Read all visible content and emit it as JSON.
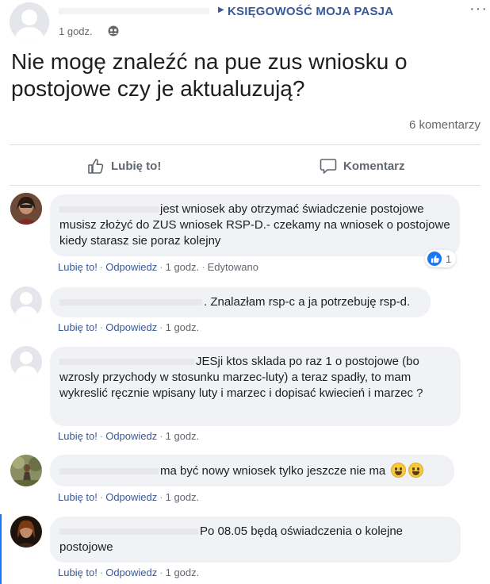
{
  "post": {
    "group_name": "KSIĘGOWOŚĆ MOJA PASJA",
    "time": "1 godz.",
    "audience_icon": "group-audience-icon",
    "more_icon": "more-dots-icon",
    "text": "Nie mogę znaleźć na pue zus wniosku o postojowe czy je aktualuzują?",
    "comments_count": "6 komentarzy"
  },
  "actions": {
    "like_label": "Lubię to!",
    "comment_label": "Komentarz"
  },
  "comments": [
    {
      "text": "jest wniosek aby otrzymać świadczenie postojowe musisz złożyć do ZUS wniosek RSP-D.- czekamy na wniosek o postojowe kiedy starasz sie poraz kolejny",
      "like": "Lubię to!",
      "reply": "Odpowiedz",
      "time": "1 godz.",
      "edited": "Edytowano",
      "reaction_count": "1"
    },
    {
      "text": ". Znalazłam rsp-c a ja potrzebuję rsp-d.",
      "like": "Lubię to!",
      "reply": "Odpowiedz",
      "time": "1 godz."
    },
    {
      "text": "JESji ktos sklada po raz 1 o postojowe (bo wzrosly przychody w stosunku marzec-luty) a teraz spadły, to mam wykreslić ręcznie wpisany luty i marzec i dopisać kwiecień i marzec ?",
      "like": "Lubię to!",
      "reply": "Odpowiedz",
      "time": "1 godz."
    },
    {
      "text": "ma być nowy wniosek tylko jeszcze nie ma",
      "like": "Lubię to!",
      "reply": "Odpowiedz",
      "time": "1 godz."
    },
    {
      "text": "Po 08.05 będą oświadczenia o kolejne postojowe",
      "like": "Lubię to!",
      "reply": "Odpowiedz",
      "time": "1 godz."
    }
  ],
  "colors": {
    "accent": "#385898",
    "bubble": "#f0f2f5",
    "muted": "#65676b",
    "like_blue": "#1877f2"
  }
}
